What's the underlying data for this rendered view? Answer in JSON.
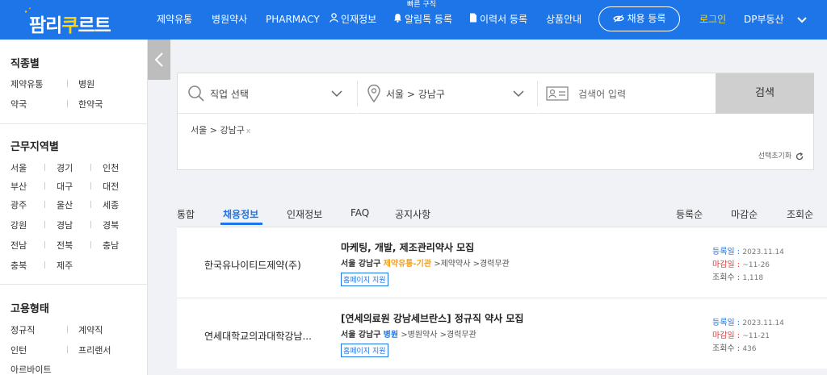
{
  "header": {
    "logo_text_1": "팜리",
    "logo_text_accent": "쿠",
    "logo_text_2": "르트",
    "nav": [
      "제약유통",
      "병원약사",
      "PHARMACY",
      "인재정보",
      "알림톡 등록",
      "이력서 등록",
      "상품안내"
    ],
    "nav_badge": "빠른 구직",
    "register_label": "채용 등록",
    "login_label": "로그인",
    "org_label": "DP부동산"
  },
  "sidebar": {
    "sections": [
      {
        "title": "직종별",
        "items": [
          "제약유통",
          "병원",
          "약국",
          "한약국"
        ]
      },
      {
        "title": "근무지역별",
        "items": [
          "서울",
          "경기",
          "인천",
          "부산",
          "대구",
          "대전",
          "광주",
          "울산",
          "세종",
          "강원",
          "경남",
          "경북",
          "전남",
          "전북",
          "충남",
          "충북",
          "제주"
        ]
      },
      {
        "title": "고용형태",
        "items": [
          "정규직",
          "계약직",
          "인턴",
          "프리랜서",
          "아르바이트"
        ]
      }
    ]
  },
  "search": {
    "job_select": "직업 선택",
    "region_select": "서울 > 강남구",
    "keyword_placeholder": "검색어 입력",
    "search_button": "검색",
    "chip": "서울 > 강남구",
    "chip_remove": "x",
    "reset_label": "선택초기화"
  },
  "tabs": {
    "items": [
      "통합",
      "채용정보",
      "인재정보",
      "FAQ",
      "공지사항"
    ],
    "active": "채용정보"
  },
  "sort": [
    "등록순",
    "마감순",
    "조회순"
  ],
  "listings": [
    {
      "company": "한국유나이티드제약(주)",
      "title": "마케팅, 개발, 제조관리약사 모집",
      "location": "서울 강남구",
      "category": "제약유통-기관",
      "category_color": "#f0a020",
      "tags": [
        ">제약약사",
        ">경력무관"
      ],
      "badge": "홈페이지 지원",
      "reg_label": "등록일 :",
      "reg_date": "2023.11.14",
      "due_label": "마감일 :",
      "due_date": "~11-26",
      "view_label": "조회수 :",
      "views": "1,118"
    },
    {
      "company": "연세대학교의과대학강남...",
      "title": "[연세의료원 강남세브란스] 정규직 약사 모집",
      "location": "서울 강남구",
      "category": "병원",
      "category_color": "#1e75e8",
      "tags": [
        ">병원약사",
        ">경력무관"
      ],
      "badge": "홈페이지 지원",
      "reg_label": "등록일 :",
      "reg_date": "2023.11.14",
      "due_label": "마감일 :",
      "due_date": "~11-21",
      "view_label": "조회수 :",
      "views": "436"
    }
  ]
}
